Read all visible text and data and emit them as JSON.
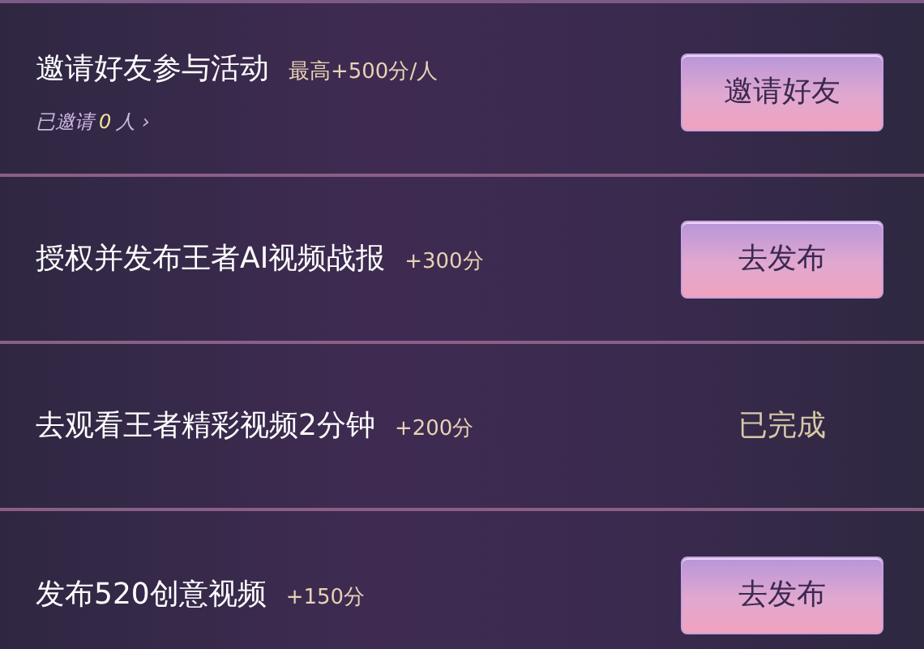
{
  "tasks": [
    {
      "title": "邀请好友参与活动",
      "reward": "最高+500分/人",
      "progress": {
        "label": "已邀请",
        "count": "0",
        "unit": "人",
        "arrow": "›"
      },
      "kind": "button",
      "action": "邀请好友"
    },
    {
      "title": "授权并发布王者AI视频战报",
      "reward": "+300分",
      "kind": "button",
      "action": "去发布"
    },
    {
      "title": "去观看王者精彩视频2分钟",
      "reward": "+200分",
      "kind": "done",
      "action": "已完成"
    },
    {
      "title": "发布520创意视频",
      "reward": "+150分",
      "kind": "button",
      "action": "去发布"
    }
  ]
}
